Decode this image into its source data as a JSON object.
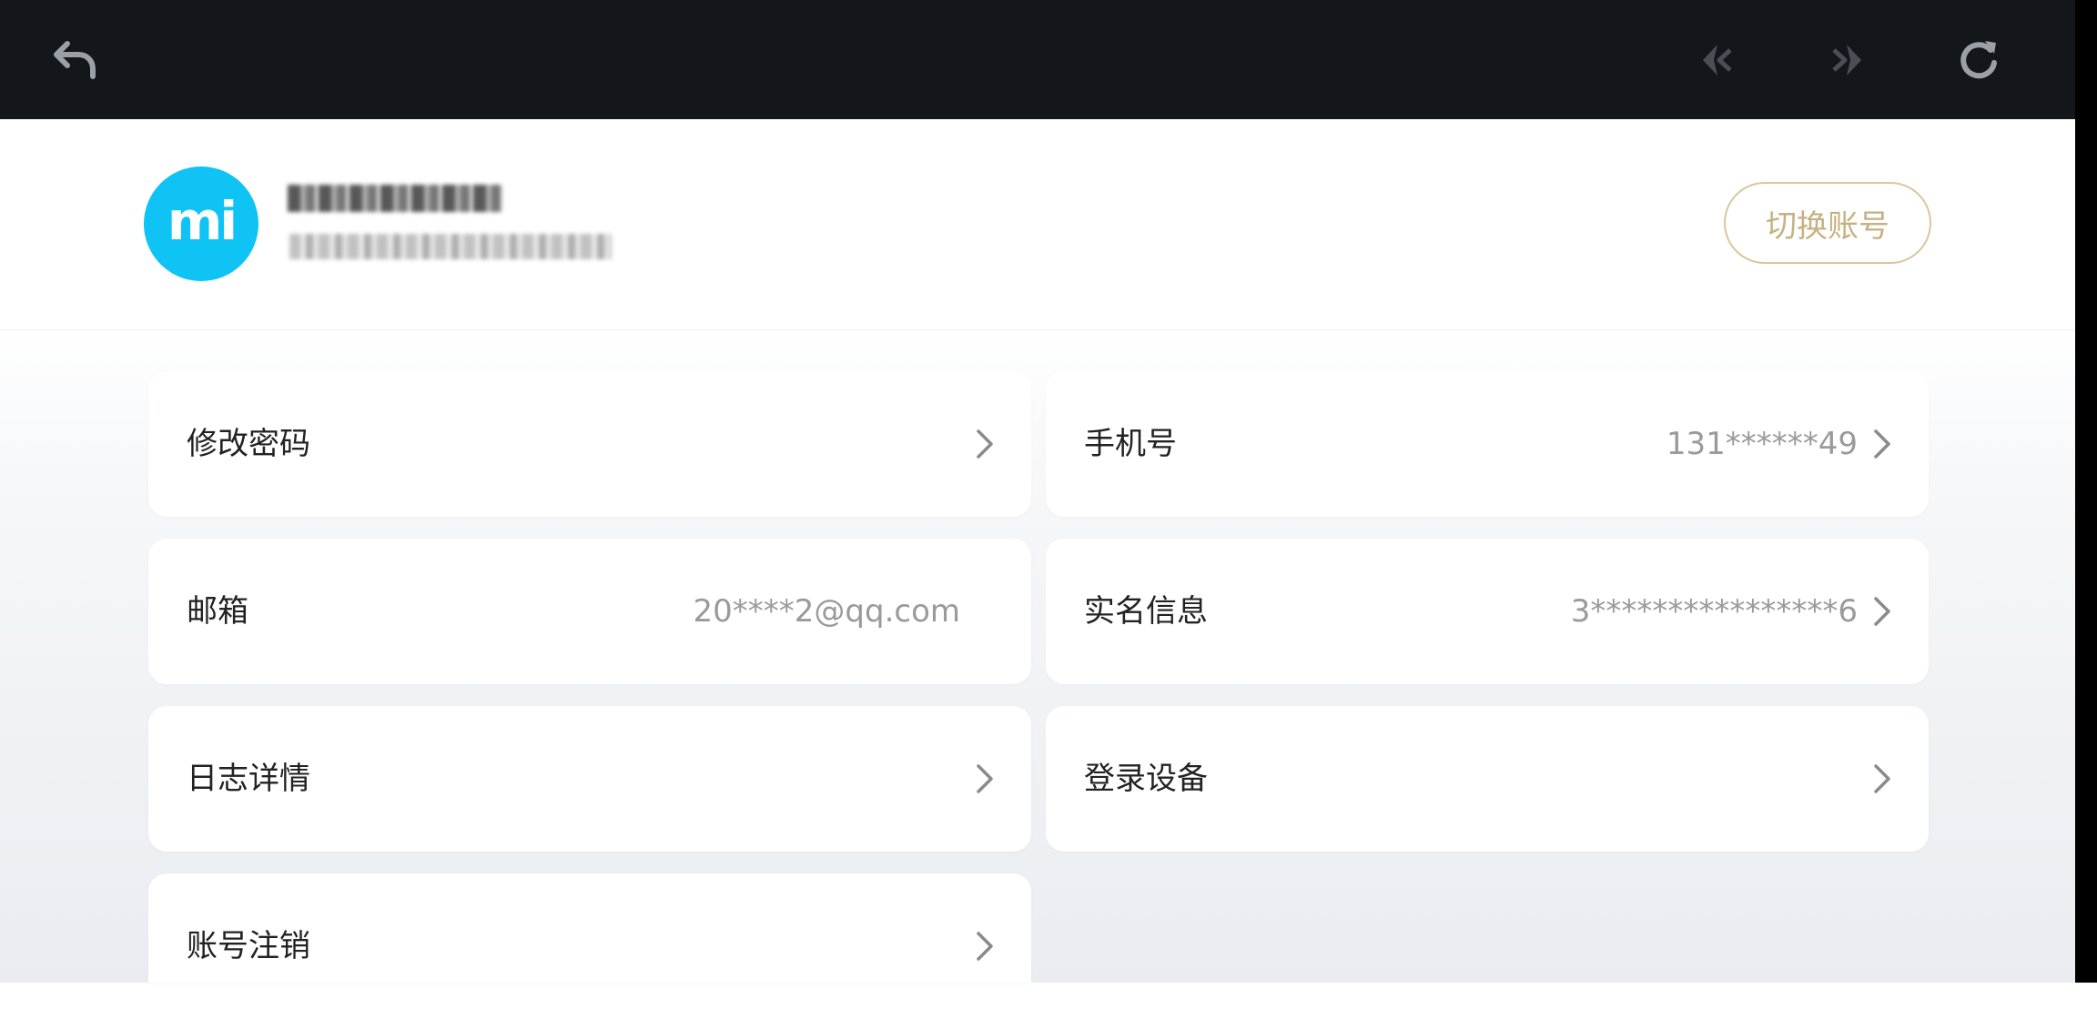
{
  "topbar": {
    "back_icon": "back-arrow-icon",
    "prev_icon": "nav-back-icon",
    "next_icon": "nav-forward-icon",
    "refresh_icon": "refresh-icon"
  },
  "header": {
    "avatar_text": "mi",
    "username": "(blurred)",
    "account_id": "(blurred)",
    "switch_label": "切换账号"
  },
  "items": [
    {
      "label": "修改密码",
      "value": "",
      "chevron": true
    },
    {
      "label": "手机号",
      "value": "131******49",
      "chevron": true
    },
    {
      "label": "邮箱",
      "value": "20****2@qq.com",
      "chevron": false
    },
    {
      "label": "实名信息",
      "value": "3****************6",
      "chevron": true
    },
    {
      "label": "日志详情",
      "value": "",
      "chevron": true
    },
    {
      "label": "登录设备",
      "value": "",
      "chevron": true
    },
    {
      "label": "账号注销",
      "value": "",
      "chevron": true
    }
  ],
  "colors": {
    "topbar_bg": "#13161a",
    "avatar_bg": "#0fc3f4",
    "accent_gold": "#c6b183"
  }
}
